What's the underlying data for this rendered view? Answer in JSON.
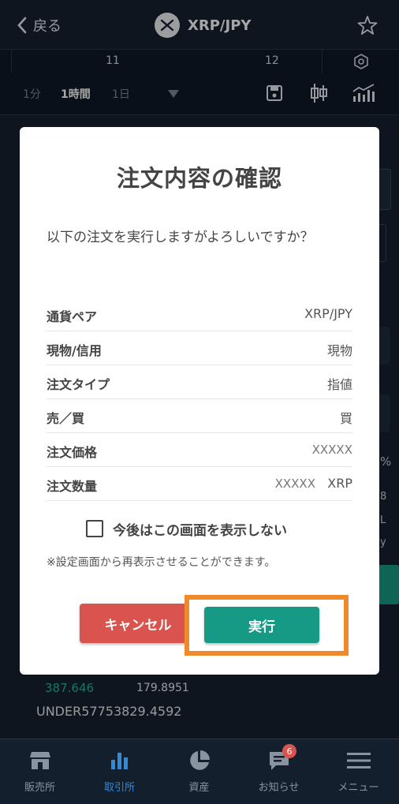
{
  "header": {
    "back_label": "戻る",
    "pair": "XRP/JPY"
  },
  "scale": {
    "labels": [
      "11",
      "12"
    ]
  },
  "toolbar": {
    "timeframes": [
      "1分",
      "1時間",
      "1日"
    ]
  },
  "background": {
    "price_green": "387.646",
    "price_white": "179.8951",
    "under_text": "UNDER57753829.4592",
    "edge_fragments": [
      "%",
      "8",
      "L",
      "y"
    ]
  },
  "modal": {
    "title": "注文内容の確認",
    "message": "以下の注文を実行しますがよろしいですか？",
    "rows": [
      {
        "label": "通貨ペア",
        "value": "XRP/JPY"
      },
      {
        "label": "現物/信用",
        "value": "現物"
      },
      {
        "label": "注文タイプ",
        "value": "指値"
      },
      {
        "label": "売／買",
        "value": "買"
      },
      {
        "label": "注文価格",
        "value": "XXXXX"
      },
      {
        "label": "注文数量",
        "value": "XXXXX",
        "unit": "XRP"
      }
    ],
    "checkbox_label": "今後はこの画面を表示しない",
    "note": "※設定画面から再表示させることができます。",
    "cancel_label": "キャンセル",
    "execute_label": "実行"
  },
  "nav": {
    "items": [
      {
        "label": "販売所",
        "icon": "store-icon"
      },
      {
        "label": "取引所",
        "icon": "bar-chart-icon"
      },
      {
        "label": "資産",
        "icon": "pie-chart-icon"
      },
      {
        "label": "お知らせ",
        "icon": "message-icon"
      },
      {
        "label": "メニュー",
        "icon": "menu-icon"
      }
    ],
    "active_index": 1,
    "notification_count": "6"
  },
  "colors": {
    "accent_green": "#169a86",
    "cancel_red": "#d9534f",
    "highlight_orange": "#f0892a",
    "nav_active": "#2e8bd8"
  }
}
